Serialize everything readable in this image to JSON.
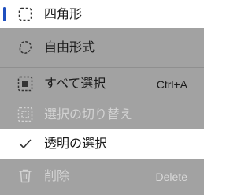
{
  "menu": {
    "items": [
      {
        "label": "四角形",
        "icon": "rectangle-select-icon",
        "selected": true
      },
      {
        "label": "自由形式",
        "icon": "freeform-select-icon"
      },
      {
        "label": "すべて選択",
        "icon": "select-all-icon",
        "shortcut": "Ctrl+A"
      },
      {
        "label": "選択の切り替え",
        "icon": "invert-selection-icon",
        "disabled": true
      },
      {
        "label": "透明の選択",
        "icon": "checkmark-icon",
        "checked": true
      },
      {
        "label": "削除",
        "icon": "trash-icon",
        "shortcut": "Delete",
        "disabled": true
      }
    ]
  },
  "colors": {
    "accent": "#1f4fbf",
    "shaded_background": "#a2a2a2",
    "disabled_text": "#d2d2d2"
  }
}
